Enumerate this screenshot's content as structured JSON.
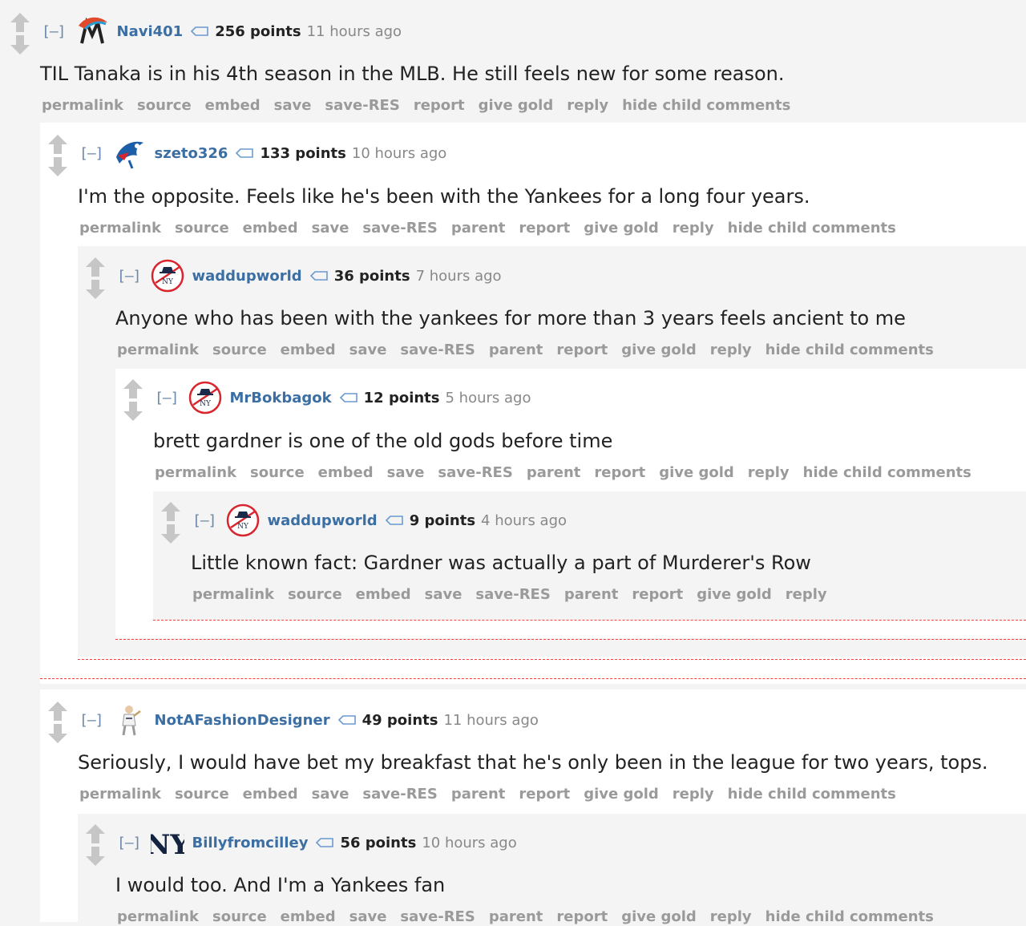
{
  "comments": [
    {
      "author": "Navi401",
      "points": "256 points",
      "time": "11 hours ago",
      "toggle": "[–]",
      "flair": "marlins-logo-icon",
      "text": "TIL Tanaka is in his 4th season in the MLB. He still feels new for some reason.",
      "buttons": [
        "permalink",
        "source",
        "embed",
        "save",
        "save-RES",
        "report",
        "give gold",
        "reply",
        "hide child comments"
      ]
    },
    {
      "author": "szeto326",
      "points": "133 points",
      "time": "10 hours ago",
      "toggle": "[–]",
      "flair": "blue-jays-logo-icon",
      "text": "I'm the opposite. Feels like he's been with the Yankees for a long four years.",
      "buttons": [
        "permalink",
        "source",
        "embed",
        "save",
        "save-RES",
        "parent",
        "report",
        "give gold",
        "reply",
        "hide child comments"
      ]
    },
    {
      "author": "waddupworld",
      "points": "36 points",
      "time": "7 hours ago",
      "toggle": "[–]",
      "flair": "yankees-top-hat-logo-icon",
      "text": "Anyone who has been with the yankees for more than 3 years feels ancient to me",
      "buttons": [
        "permalink",
        "source",
        "embed",
        "save",
        "save-RES",
        "parent",
        "report",
        "give gold",
        "reply",
        "hide child comments"
      ]
    },
    {
      "author": "MrBokbagok",
      "points": "12 points",
      "time": "5 hours ago",
      "toggle": "[–]",
      "flair": "yankees-top-hat-logo-icon",
      "text": "brett gardner is one of the old gods before time",
      "buttons": [
        "permalink",
        "source",
        "embed",
        "save",
        "save-RES",
        "parent",
        "report",
        "give gold",
        "reply",
        "hide child comments"
      ]
    },
    {
      "author": "waddupworld",
      "points": "9 points",
      "time": "4 hours ago",
      "toggle": "[–]",
      "flair": "yankees-top-hat-logo-icon",
      "text": "Little known fact: Gardner was actually a part of Murderer's Row",
      "buttons": [
        "permalink",
        "source",
        "embed",
        "save",
        "save-RES",
        "parent",
        "report",
        "give gold",
        "reply"
      ]
    },
    {
      "author": "NotAFashionDesigner",
      "points": "49 points",
      "time": "11 hours ago",
      "toggle": "[–]",
      "flair": "player-figure-icon",
      "text": "Seriously, I would have bet my breakfast that he's only been in the league for two years, tops.",
      "buttons": [
        "permalink",
        "source",
        "embed",
        "save",
        "save-RES",
        "parent",
        "report",
        "give gold",
        "reply",
        "hide child comments"
      ]
    },
    {
      "author": "Billyfromcilley",
      "points": "56 points",
      "time": "10 hours ago",
      "toggle": "[–]",
      "flair": "yankees-ny-logo-icon",
      "text": "I would too. And I'm a Yankees fan",
      "buttons": [
        "permalink",
        "source",
        "embed",
        "save",
        "save-RES",
        "parent",
        "report",
        "give gold",
        "reply",
        "hide child comments"
      ]
    }
  ],
  "colors": {
    "author": "#3b6ea3",
    "button": "#9a9a9a",
    "time": "#888888",
    "collapse_dash": "#ff3c3c",
    "arrow": "#c6c6c6"
  }
}
